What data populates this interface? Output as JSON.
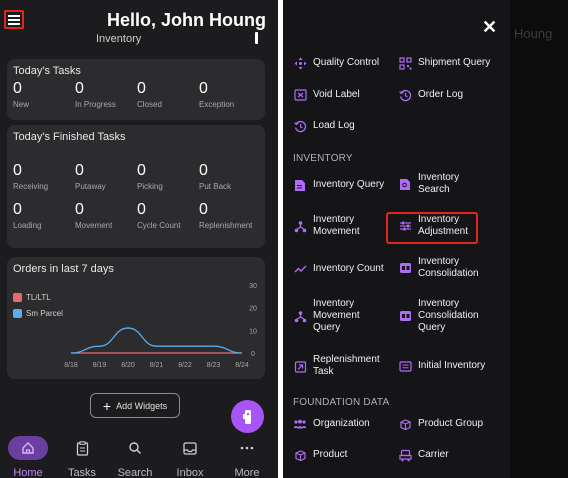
{
  "left": {
    "greeting": "Hello, John Houng",
    "ghost_tab": "Inventory",
    "todays_tasks": {
      "title": "Today's Tasks",
      "stats": [
        {
          "value": "0",
          "label": "New"
        },
        {
          "value": "0",
          "label": "In Progress"
        },
        {
          "value": "0",
          "label": "Closed"
        },
        {
          "value": "0",
          "label": "Exception"
        }
      ]
    },
    "finished_tasks": {
      "title": "Today's Finished Tasks",
      "stats": [
        {
          "value": "0",
          "label": "Receiving"
        },
        {
          "value": "0",
          "label": "Putaway"
        },
        {
          "value": "0",
          "label": "Picking"
        },
        {
          "value": "0",
          "label": "Put Back"
        },
        {
          "value": "0",
          "label": "Loading"
        },
        {
          "value": "0",
          "label": "Movement"
        },
        {
          "value": "0",
          "label": "Cycle Count"
        },
        {
          "value": "0",
          "label": "Replenishment"
        }
      ]
    },
    "orders": {
      "title": "Orders in last 7 days",
      "legend": [
        {
          "name": "TL/LTL",
          "color": "#e8696d"
        },
        {
          "name": "Sm Parcel",
          "color": "#5aaef0"
        }
      ]
    },
    "add_widgets_label": "Add Widgets",
    "nav": [
      {
        "label": "Home",
        "icon": "home-icon"
      },
      {
        "label": "Tasks",
        "icon": "clipboard-icon"
      },
      {
        "label": "Search",
        "icon": "search-icon"
      },
      {
        "label": "Inbox",
        "icon": "inbox-icon"
      },
      {
        "label": "More",
        "icon": "more-icon"
      }
    ]
  },
  "chart_data": {
    "type": "line",
    "x": [
      "8/18",
      "8/19",
      "8/20",
      "8/21",
      "8/22",
      "8/23",
      "8/24"
    ],
    "series": [
      {
        "name": "TL/LTL",
        "color": "#e8696d",
        "values": [
          0,
          0,
          0,
          0,
          0,
          0,
          0
        ]
      },
      {
        "name": "Sm Parcel",
        "color": "#5aaef0",
        "values": [
          0,
          3,
          11,
          3,
          3,
          3,
          0
        ]
      }
    ],
    "yticks": [
      "0",
      "10",
      "20",
      "30"
    ],
    "ylim": [
      0,
      30
    ],
    "title": "Orders in last 7 days"
  },
  "right": {
    "ghost_name": "Houng",
    "items_top": [
      {
        "label": "Quality Control",
        "icon": "move-arrows-icon"
      },
      {
        "label": "Shipment Query",
        "icon": "qr-code-icon"
      },
      {
        "label": "Void Label",
        "icon": "void-label-icon"
      },
      {
        "label": "Order Log",
        "icon": "history-icon"
      },
      {
        "label": "Load Log",
        "icon": "history-icon"
      }
    ],
    "section_inventory": "INVENTORY",
    "items_inventory": [
      {
        "label": "Inventory Query",
        "icon": "document-icon"
      },
      {
        "label": "Inventory Search",
        "icon": "document-search-icon"
      },
      {
        "label": "Inventory Movement",
        "icon": "movement-icon"
      },
      {
        "label": "Inventory Adjustment",
        "icon": "sliders-icon"
      },
      {
        "label": "Inventory Count",
        "icon": "trend-icon"
      },
      {
        "label": "Inventory Consolidation",
        "icon": "consolidation-icon"
      },
      {
        "label": "Inventory Movement Query",
        "icon": "movement-icon"
      },
      {
        "label": "Inventory Consolidation Query",
        "icon": "consolidation-icon"
      },
      {
        "label": "Replenishment Task",
        "icon": "replenish-icon"
      },
      {
        "label": "Initial Inventory",
        "icon": "list-box-icon"
      }
    ],
    "section_foundation": "FOUNDATION DATA",
    "items_foundation": [
      {
        "label": "Organization",
        "icon": "people-icon"
      },
      {
        "label": "Product Group",
        "icon": "product-group-icon"
      },
      {
        "label": "Product",
        "icon": "box-icon"
      },
      {
        "label": "Carrier",
        "icon": "truck-icon"
      }
    ]
  },
  "colors": {
    "accent": "#a855f7",
    "highlight": "#e0271f",
    "background": "#1c1c1e",
    "card": "#2c2c2e"
  }
}
